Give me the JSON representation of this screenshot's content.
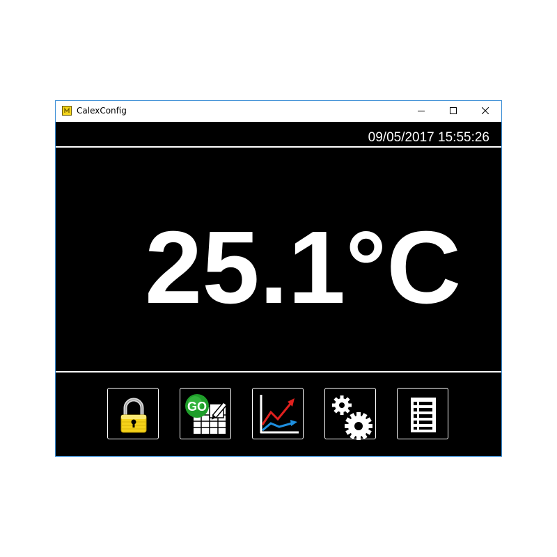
{
  "window": {
    "title": "CalexConfig",
    "controls": [
      "minimize",
      "maximize",
      "close"
    ]
  },
  "status": {
    "datetime": "09/05/2017 15:55:26"
  },
  "reading": {
    "value": "25.1",
    "unit": "°C"
  },
  "toolbar": {
    "buttons": [
      {
        "icon": "padlock-icon",
        "go_label": ""
      },
      {
        "icon": "go-sheet-icon",
        "go_label": "GO"
      },
      {
        "icon": "trend-chart-icon",
        "go_label": ""
      },
      {
        "icon": "gears-icon",
        "go_label": ""
      },
      {
        "icon": "list-icon",
        "go_label": ""
      }
    ]
  },
  "colors": {
    "background": "#000000",
    "foreground": "#ffffff",
    "window_border": "#3c8fd6",
    "padlock": "#f5d21a",
    "go_badge": "#1f9e2a",
    "trend_red": "#e0201e",
    "trend_blue": "#1e8fe0"
  }
}
